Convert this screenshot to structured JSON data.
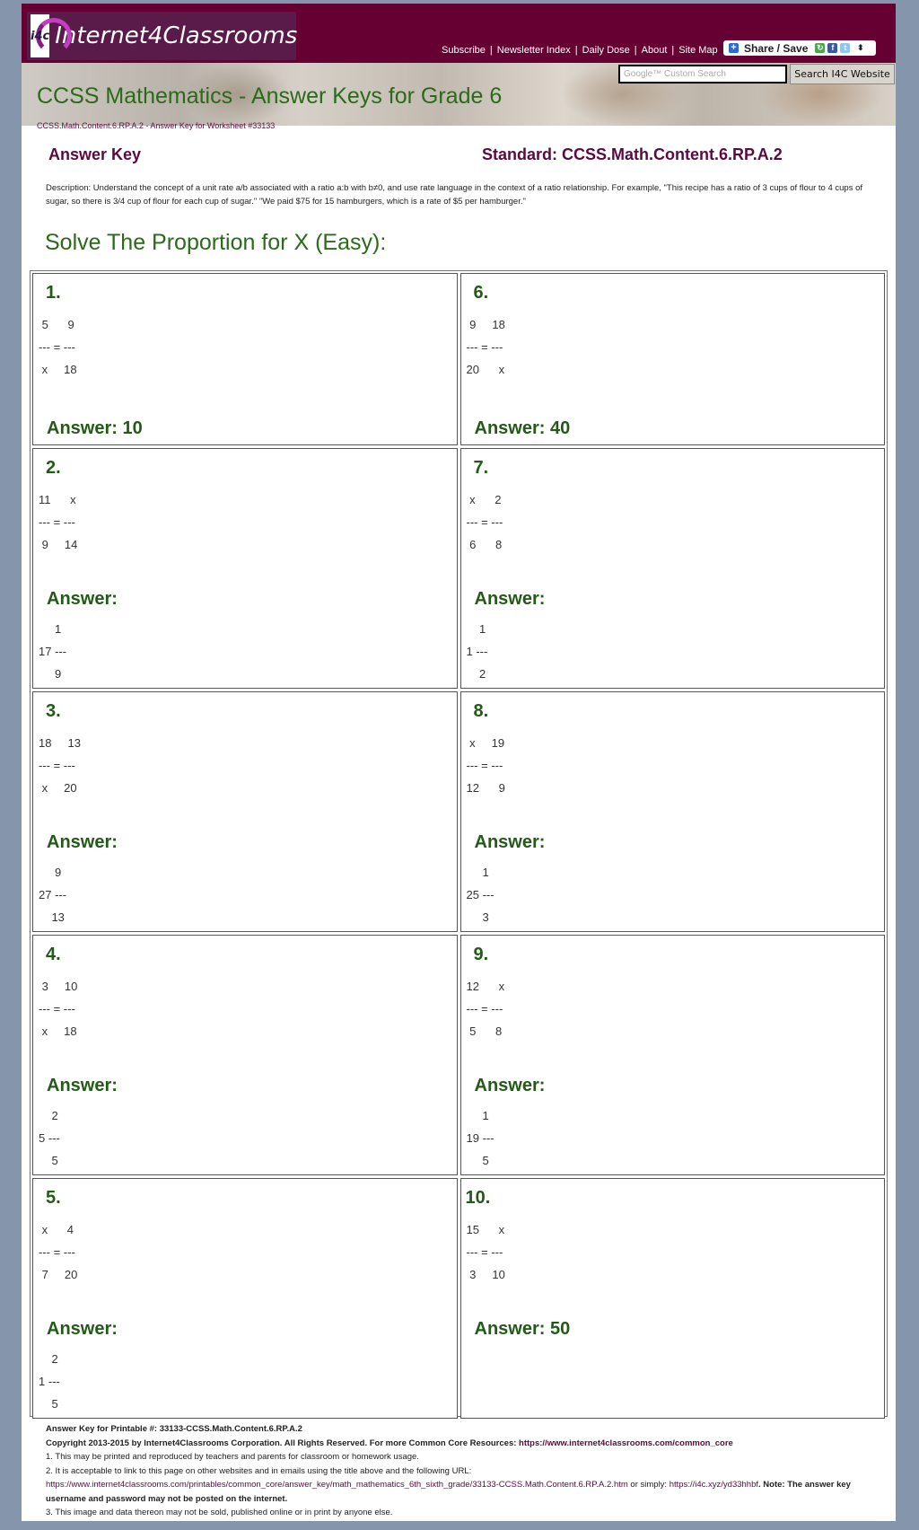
{
  "header": {
    "logo_badge": "i4c",
    "logo_text": "Internet4Classrooms",
    "nav": [
      "Subscribe",
      "Newsletter Index",
      "Daily Dose",
      "About",
      "Site Map"
    ],
    "share_label": "Share / Save",
    "search_placeholder": "Google™ Custom Search",
    "search_button": "Search I4C Website",
    "colors": {
      "brand": "#660033",
      "title_green": "#2a6a1a"
    }
  },
  "banner": {
    "title": "CCSS Mathematics - Answer Keys for Grade 6",
    "breadcrumb": "CCSS.Math.Content.6.RP.A.2 - Answer Key for Worksheet #33133"
  },
  "answer_key": {
    "title": "Answer Key",
    "standard": "Standard: CCSS.Math.Content.6.RP.A.2",
    "description": "Description: Understand the concept of a unit rate a/b associated with a ratio a:b with b≠0, and use rate language in the context of a ratio relationship. For example, \"This recipe has a ratio of 3 cups of flour to 4 cups of sugar, so there is 3/4 cup of flour for each cup of sugar.\" \"We paid $75 for 15 hamburgers, which is a rate of $5 per hamburger.\""
  },
  "section_title": "Solve The Proportion for X (Easy):",
  "problems": [
    {
      "num": "1.",
      "eq": " 5      9\n--- = ---\n x     18",
      "answer_label": "Answer: 10",
      "answer_frac": ""
    },
    {
      "num": "6.",
      "eq": " 9     18\n--- = ---\n20      x",
      "answer_label": "Answer: 40",
      "answer_frac": ""
    },
    {
      "num": "2.",
      "eq": "11      x\n--- = ---\n 9     14",
      "answer_label": "Answer:",
      "answer_frac": "     1\n17 ---\n     9"
    },
    {
      "num": "7.",
      "eq": " x      2\n--- = ---\n 6      8",
      "answer_label": "Answer:",
      "answer_frac": "    1\n1 ---\n    2"
    },
    {
      "num": "3.",
      "eq": "18     13\n--- = ---\n x     20",
      "answer_label": "Answer:",
      "answer_frac": "     9\n27 ---\n    13"
    },
    {
      "num": "8.",
      "eq": " x     19\n--- = ---\n12      9",
      "answer_label": "Answer:",
      "answer_frac": "     1\n25 ---\n     3"
    },
    {
      "num": "4.",
      "eq": " 3     10\n--- = ---\n x     18",
      "answer_label": "Answer:",
      "answer_frac": "    2\n5 ---\n    5"
    },
    {
      "num": "9.",
      "eq": "12      x\n--- = ---\n 5      8",
      "answer_label": "Answer:",
      "answer_frac": "     1\n19 ---\n     5"
    },
    {
      "num": "5.",
      "eq": " x      4\n--- = ---\n 7     20",
      "answer_label": "Answer:",
      "answer_frac": "    2\n1 ---\n    5"
    },
    {
      "num": "10.",
      "eq": "15      x\n--- = ---\n 3     10",
      "answer_label": "Answer: 50",
      "answer_frac": ""
    }
  ],
  "footer": {
    "printable": "Answer Key for Printable #: 33133-CCSS.Math.Content.6.RP.A.2",
    "copyright": "Copyright 2013-2015 by Internet4Classrooms Corporation. All Rights Reserved. For more Common Core Resources:",
    "cc_link": "https://www.internet4classrooms.com/common_core",
    "rule1": "1. This may be printed and reproduced by teachers and parents for classroom or homework usage.",
    "rule2": "2. It is acceptable to link to this page on other websites and in emails using the title above and the following URL:",
    "url_long": "https://www.internet4classrooms.com/printables/common_core/answer_key/math_mathematics_6th_sixth_grade/33133-CCSS.Math.Content.6.RP.A.2.htm",
    "or_simply": " or simply: ",
    "url_short": "https://i4c.xyz/yd33hhbf",
    "note": ". Note: The answer key username and password may not be posted on the internet.",
    "rule3": "3. This image and data thereon may not be sold, published online or in print by anyone else."
  }
}
